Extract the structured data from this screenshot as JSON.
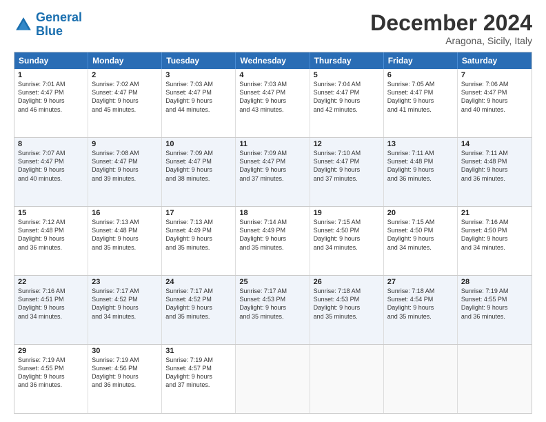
{
  "logo": {
    "line1": "General",
    "line2": "Blue"
  },
  "title": "December 2024",
  "subtitle": "Aragona, Sicily, Italy",
  "headers": [
    "Sunday",
    "Monday",
    "Tuesday",
    "Wednesday",
    "Thursday",
    "Friday",
    "Saturday"
  ],
  "rows": [
    [
      {
        "day": "1",
        "text": "Sunrise: 7:01 AM\nSunset: 4:47 PM\nDaylight: 9 hours\nand 46 minutes."
      },
      {
        "day": "2",
        "text": "Sunrise: 7:02 AM\nSunset: 4:47 PM\nDaylight: 9 hours\nand 45 minutes."
      },
      {
        "day": "3",
        "text": "Sunrise: 7:03 AM\nSunset: 4:47 PM\nDaylight: 9 hours\nand 44 minutes."
      },
      {
        "day": "4",
        "text": "Sunrise: 7:03 AM\nSunset: 4:47 PM\nDaylight: 9 hours\nand 43 minutes."
      },
      {
        "day": "5",
        "text": "Sunrise: 7:04 AM\nSunset: 4:47 PM\nDaylight: 9 hours\nand 42 minutes."
      },
      {
        "day": "6",
        "text": "Sunrise: 7:05 AM\nSunset: 4:47 PM\nDaylight: 9 hours\nand 41 minutes."
      },
      {
        "day": "7",
        "text": "Sunrise: 7:06 AM\nSunset: 4:47 PM\nDaylight: 9 hours\nand 40 minutes."
      }
    ],
    [
      {
        "day": "8",
        "text": "Sunrise: 7:07 AM\nSunset: 4:47 PM\nDaylight: 9 hours\nand 40 minutes."
      },
      {
        "day": "9",
        "text": "Sunrise: 7:08 AM\nSunset: 4:47 PM\nDaylight: 9 hours\nand 39 minutes."
      },
      {
        "day": "10",
        "text": "Sunrise: 7:09 AM\nSunset: 4:47 PM\nDaylight: 9 hours\nand 38 minutes."
      },
      {
        "day": "11",
        "text": "Sunrise: 7:09 AM\nSunset: 4:47 PM\nDaylight: 9 hours\nand 37 minutes."
      },
      {
        "day": "12",
        "text": "Sunrise: 7:10 AM\nSunset: 4:47 PM\nDaylight: 9 hours\nand 37 minutes."
      },
      {
        "day": "13",
        "text": "Sunrise: 7:11 AM\nSunset: 4:48 PM\nDaylight: 9 hours\nand 36 minutes."
      },
      {
        "day": "14",
        "text": "Sunrise: 7:11 AM\nSunset: 4:48 PM\nDaylight: 9 hours\nand 36 minutes."
      }
    ],
    [
      {
        "day": "15",
        "text": "Sunrise: 7:12 AM\nSunset: 4:48 PM\nDaylight: 9 hours\nand 36 minutes."
      },
      {
        "day": "16",
        "text": "Sunrise: 7:13 AM\nSunset: 4:48 PM\nDaylight: 9 hours\nand 35 minutes."
      },
      {
        "day": "17",
        "text": "Sunrise: 7:13 AM\nSunset: 4:49 PM\nDaylight: 9 hours\nand 35 minutes."
      },
      {
        "day": "18",
        "text": "Sunrise: 7:14 AM\nSunset: 4:49 PM\nDaylight: 9 hours\nand 35 minutes."
      },
      {
        "day": "19",
        "text": "Sunrise: 7:15 AM\nSunset: 4:50 PM\nDaylight: 9 hours\nand 34 minutes."
      },
      {
        "day": "20",
        "text": "Sunrise: 7:15 AM\nSunset: 4:50 PM\nDaylight: 9 hours\nand 34 minutes."
      },
      {
        "day": "21",
        "text": "Sunrise: 7:16 AM\nSunset: 4:50 PM\nDaylight: 9 hours\nand 34 minutes."
      }
    ],
    [
      {
        "day": "22",
        "text": "Sunrise: 7:16 AM\nSunset: 4:51 PM\nDaylight: 9 hours\nand 34 minutes."
      },
      {
        "day": "23",
        "text": "Sunrise: 7:17 AM\nSunset: 4:52 PM\nDaylight: 9 hours\nand 34 minutes."
      },
      {
        "day": "24",
        "text": "Sunrise: 7:17 AM\nSunset: 4:52 PM\nDaylight: 9 hours\nand 35 minutes."
      },
      {
        "day": "25",
        "text": "Sunrise: 7:17 AM\nSunset: 4:53 PM\nDaylight: 9 hours\nand 35 minutes."
      },
      {
        "day": "26",
        "text": "Sunrise: 7:18 AM\nSunset: 4:53 PM\nDaylight: 9 hours\nand 35 minutes."
      },
      {
        "day": "27",
        "text": "Sunrise: 7:18 AM\nSunset: 4:54 PM\nDaylight: 9 hours\nand 35 minutes."
      },
      {
        "day": "28",
        "text": "Sunrise: 7:19 AM\nSunset: 4:55 PM\nDaylight: 9 hours\nand 36 minutes."
      }
    ],
    [
      {
        "day": "29",
        "text": "Sunrise: 7:19 AM\nSunset: 4:55 PM\nDaylight: 9 hours\nand 36 minutes."
      },
      {
        "day": "30",
        "text": "Sunrise: 7:19 AM\nSunset: 4:56 PM\nDaylight: 9 hours\nand 36 minutes."
      },
      {
        "day": "31",
        "text": "Sunrise: 7:19 AM\nSunset: 4:57 PM\nDaylight: 9 hours\nand 37 minutes."
      },
      {
        "day": "",
        "text": ""
      },
      {
        "day": "",
        "text": ""
      },
      {
        "day": "",
        "text": ""
      },
      {
        "day": "",
        "text": ""
      }
    ]
  ]
}
